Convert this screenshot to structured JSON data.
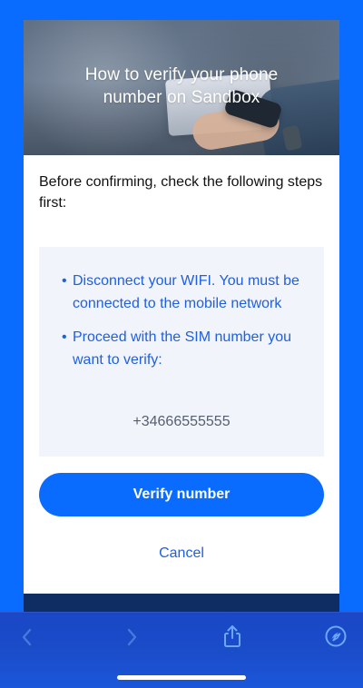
{
  "dialog": {
    "title": "How to verify your phone number on Sandbox",
    "intro": "Before confirming, check the following steps first:",
    "steps": [
      {
        "bullet": "•",
        "text": "Disconnect your WIFI. You must be connected to the mobile network"
      },
      {
        "bullet": "•",
        "text": "Proceed with the SIM number you want to verify:"
      }
    ],
    "phone_number": "+34666555555",
    "verify_label": "Verify number",
    "cancel_label": "Cancel"
  },
  "toolbar": {
    "icons": [
      {
        "name": "back-icon"
      },
      {
        "name": "forward-icon"
      },
      {
        "name": "share-icon"
      },
      {
        "name": "compass-icon"
      }
    ]
  },
  "colors": {
    "background": "#0a6cff",
    "button": "#0a6cff",
    "accent_text": "#1f5fe0",
    "panel": "#f1f4fb",
    "toolbar": "#1b4cc9"
  }
}
